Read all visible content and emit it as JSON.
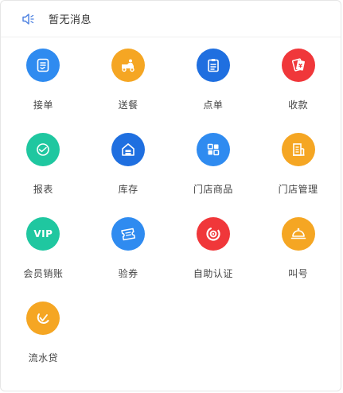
{
  "notice": {
    "text": "暂无消息",
    "icon": "speaker-icon",
    "icon_color": "#4a7fe0"
  },
  "apps": [
    [
      {
        "label": "接单",
        "icon": "order-receive-icon",
        "color": "#2f8bf0"
      },
      {
        "label": "送餐",
        "icon": "delivery-icon",
        "color": "#f5a623"
      },
      {
        "label": "点单",
        "icon": "clipboard-icon",
        "color": "#1f6fe0"
      },
      {
        "label": "收款",
        "icon": "payment-icon",
        "color": "#f0373a"
      }
    ],
    [
      {
        "label": "报表",
        "icon": "report-icon",
        "color": "#1fc7a0"
      },
      {
        "label": "库存",
        "icon": "warehouse-icon",
        "color": "#1f6fe0"
      },
      {
        "label": "门店商品",
        "icon": "store-goods-icon",
        "color": "#2f8bf0"
      },
      {
        "label": "门店管理",
        "icon": "store-manage-icon",
        "color": "#f5a623"
      }
    ],
    [
      {
        "label": "会员销账",
        "icon": "vip-icon",
        "icon_text": "VIP",
        "color": "#1fc7a0"
      },
      {
        "label": "验券",
        "icon": "coupon-icon",
        "color": "#2f8bf0"
      },
      {
        "label": "自助认证",
        "icon": "self-auth-icon",
        "color": "#f0373a"
      },
      {
        "label": "叫号",
        "icon": "bell-icon",
        "color": "#f5a623"
      }
    ],
    [
      {
        "label": "流水贷",
        "icon": "loan-icon",
        "color": "#f5a623"
      }
    ]
  ]
}
